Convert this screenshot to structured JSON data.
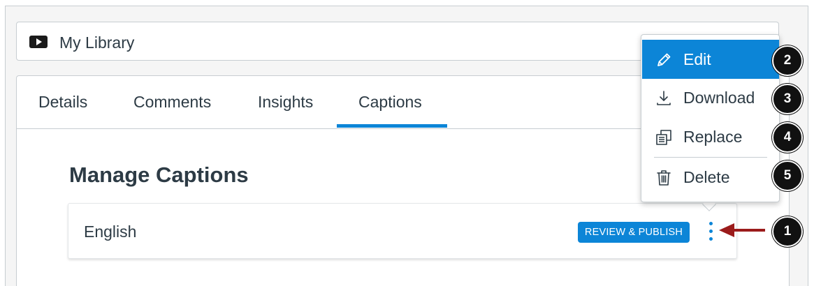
{
  "library": {
    "title": "My Library",
    "icon": "video-play-icon"
  },
  "tabs": [
    {
      "label": "Details"
    },
    {
      "label": "Comments"
    },
    {
      "label": "Insights"
    },
    {
      "label": "Captions",
      "active": true
    }
  ],
  "section": {
    "title": "Manage Captions"
  },
  "caption": {
    "language": "English",
    "action_label": "REVIEW & PUBLISH"
  },
  "menu": {
    "items": [
      {
        "label": "Edit",
        "icon": "pencil-icon",
        "active": true
      },
      {
        "label": "Download",
        "icon": "download-icon"
      },
      {
        "label": "Replace",
        "icon": "replace-icon"
      },
      {
        "label": "Delete",
        "icon": "trash-icon"
      }
    ]
  },
  "callouts": [
    "1",
    "2",
    "3",
    "4",
    "5"
  ],
  "colors": {
    "accent": "#0c85d7",
    "text": "#2d3b45",
    "arrow": "#9b1b1b"
  }
}
